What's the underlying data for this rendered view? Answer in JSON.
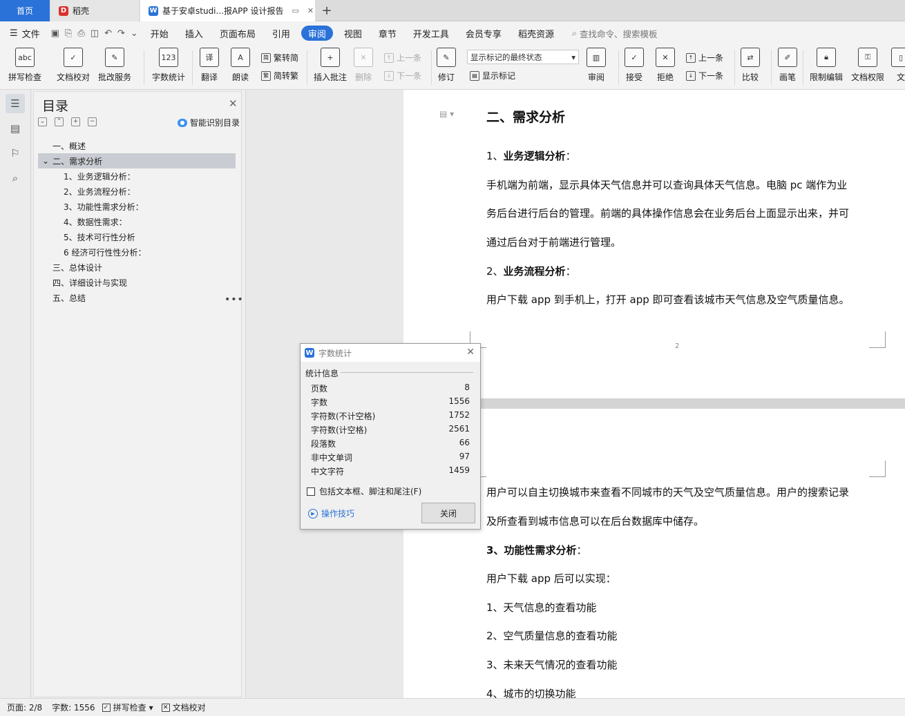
{
  "tabs": {
    "home": "首页",
    "daoke": "稻壳",
    "doc": "基于安卓studi...报APP 设计报告",
    "add": "+"
  },
  "menubar": {
    "file": "文件",
    "items": [
      "开始",
      "插入",
      "页面布局",
      "引用",
      "审阅",
      "视图",
      "章节",
      "开发工具",
      "会员专享",
      "稻壳资源"
    ],
    "active": "审阅",
    "search": "查找命令、搜索模板"
  },
  "ribbon": {
    "spell": "拼写检查",
    "proof": "文档校对",
    "correct": "批改服务",
    "wordcount": "字数统计",
    "translate": "翻译",
    "read": "朗读",
    "to_trad": "繁转简",
    "to_simp": "简转繁",
    "insert_comment": "插入批注",
    "delete": "删除",
    "prev_comment": "上一条",
    "next_comment": "下一条",
    "revise": "修订",
    "markup_combo": "显示标记的最终状态",
    "show_markup": "显示标记",
    "review": "审阅",
    "accept": "接受",
    "reject": "拒绝",
    "prev_change": "上一条",
    "next_change": "下一条",
    "compare": "比较",
    "pen": "画笔",
    "restrict": "限制编辑",
    "permission": "文档权限",
    "more": "文"
  },
  "toc": {
    "title": "目录",
    "smart": "智能识别目录",
    "items": [
      "一、概述",
      "二、需求分析",
      "1、业务逻辑分析：",
      "2、业务流程分析：",
      "3、功能性需求分析：",
      "4、数据性需求：",
      "5、技术可行性分析",
      "6 经济可行性性分析：",
      "三、总体设计",
      "四、详细设计与实现",
      "五、总结"
    ]
  },
  "document": {
    "heading": "二、需求分析",
    "s1_num": "1、",
    "s1_title": "业务逻辑分析",
    "s1_colon": "：",
    "p1_line1": "手机端为前端，显示具体天气信息并可以查询具体天气信息。电脑 pc 端作为业",
    "p1_line2": "务后台进行后台的管理。前端的具体操作信息会在业务后台上面显示出来，并可",
    "p1_line3": "通过后台对于前端进行管理。",
    "s2_num": "2、",
    "s2_title": "业务流程分析",
    "s2_colon": "：",
    "p2_line1": "用户下载 app 到手机上，打开 app 即可查看该城市天气信息及空气质量信息。",
    "page_number": "2",
    "p3_line1": "用户可以自主切换城市来查看不同城市的天气及空气质量信息。用户的搜索记录",
    "p3_line2": "及所查看到城市信息可以在后台数据库中储存。",
    "s3_title": "3、功能性需求分析",
    "s3_colon": "：",
    "p4": "用户下载 app 后可以实现：",
    "f1": "1、天气信息的查看功能",
    "f2": "2、空气质量信息的查看功能",
    "f3": "3、未来天气情况的查看功能",
    "f4": "4、城市的切换功能"
  },
  "dialog": {
    "title": "字数统计",
    "group": "统计信息",
    "rows": [
      {
        "label": "页数",
        "value": "8"
      },
      {
        "label": "字数",
        "value": "1556"
      },
      {
        "label": "字符数(不计空格)",
        "value": "1752"
      },
      {
        "label": "字符数(计空格)",
        "value": "2561"
      },
      {
        "label": "段落数",
        "value": "66"
      },
      {
        "label": "非中文单词",
        "value": "97"
      },
      {
        "label": "中文字符",
        "value": "1459"
      }
    ],
    "checkbox": "包括文本框、脚注和尾注(F)",
    "tips": "操作技巧",
    "close": "关闭"
  },
  "status": {
    "page": "页面: 2/8",
    "words": "字数: 1556",
    "spell": "拼写检查",
    "proof": "文档校对"
  },
  "colors": {
    "accent": "#2a72d8",
    "toc_selected": "#c9ccd2"
  }
}
